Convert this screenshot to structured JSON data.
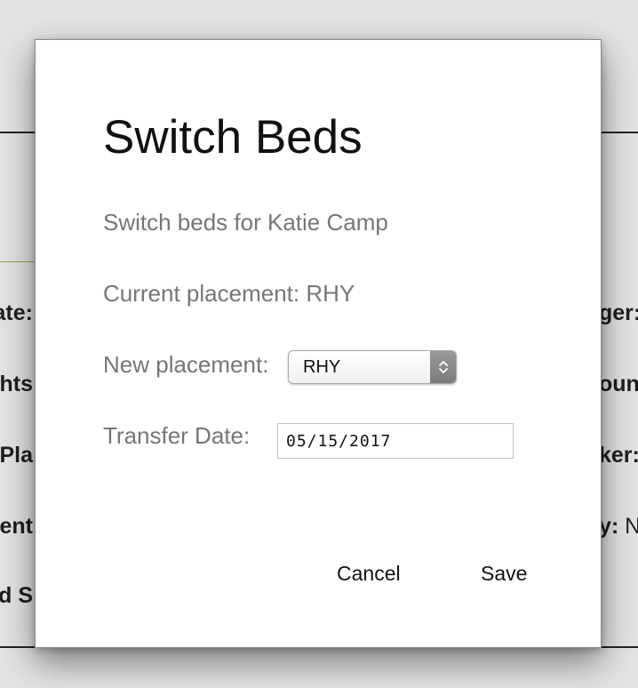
{
  "background": {
    "left_fragments": [
      "ate:",
      "hts",
      "Pla",
      "ent ",
      "ed S"
    ],
    "right_fragments": [
      {
        "bold": "ger:",
        "normal": ""
      },
      {
        "bold": "oun",
        "normal": ""
      },
      {
        "bold": "ker:",
        "normal": ""
      },
      {
        "bold": "y:",
        "normal": " N"
      }
    ]
  },
  "modal": {
    "title": "Switch Beds",
    "subtitle": "Switch beds for Katie Camp",
    "current_placement": "Current placement: RHY",
    "new_placement_label": "New placement:",
    "new_placement_value": "RHY",
    "transfer_date_label": "Transfer Date:",
    "transfer_date_value": "05/15/2017",
    "cancel_label": "Cancel",
    "save_label": "Save"
  },
  "colors": {
    "modal_background": "#ffffff",
    "label_text": "#767676",
    "title_text": "#111111",
    "backdrop": "#e3e3e3",
    "accent_green": "#8aad3a"
  },
  "icons": {
    "select_arrows": "up-down-chevron-icon"
  }
}
